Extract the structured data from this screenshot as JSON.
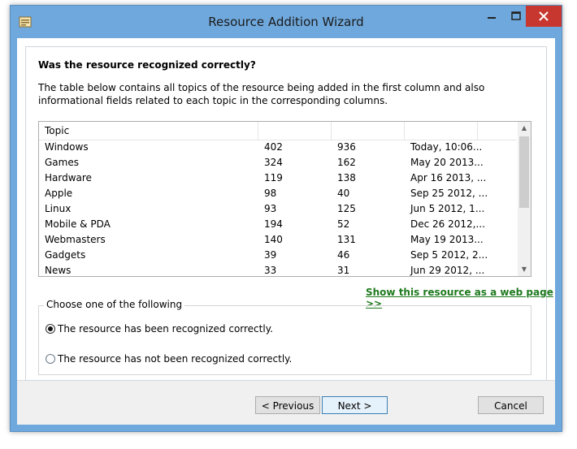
{
  "window": {
    "title": "Resource Addition Wizard"
  },
  "colors": {
    "titlebar": "#6fa8dc",
    "close": "#c7372f",
    "link": "#1f7a1f"
  },
  "icons": {
    "app": "wizard-app-icon",
    "minimize": "minimize-icon",
    "maximize": "maximize-icon",
    "close": "close-icon"
  },
  "page": {
    "heading": "Was the resource recognized correctly?",
    "description": "The table below contains all topics of the resource being added in the first column and also informational fields related to each topic in the corresponding columns."
  },
  "table": {
    "columns": [
      "Topic",
      "",
      "",
      ""
    ],
    "rows": [
      [
        "Windows",
        "402",
        "936",
        "Today, 10:06..."
      ],
      [
        "Games",
        "324",
        "162",
        "May 20 2013..."
      ],
      [
        "Hardware",
        "119",
        "138",
        "Apr 16 2013, ..."
      ],
      [
        "Apple",
        "98",
        "40",
        "Sep 25 2012, ..."
      ],
      [
        "Linux",
        "93",
        "125",
        "Jun 5 2012, 1..."
      ],
      [
        "Mobile & PDA",
        "194",
        "52",
        "Dec 26 2012,..."
      ],
      [
        "Webmasters",
        "140",
        "131",
        "May 19 2013..."
      ],
      [
        "Gadgets",
        "39",
        "46",
        "Sep 5 2012, 2..."
      ],
      [
        "News",
        "33",
        "31",
        "Jun 29 2012, ..."
      ]
    ]
  },
  "link": {
    "label": "Show this resource as a web page >>"
  },
  "choice": {
    "legend": "Choose one of the following",
    "options": [
      {
        "label": "The resource has been recognized correctly.",
        "checked": true
      },
      {
        "label": "The resource has not been recognized correctly.",
        "checked": false
      }
    ]
  },
  "buttons": {
    "previous": "< Previous",
    "next": "Next >",
    "cancel": "Cancel"
  }
}
